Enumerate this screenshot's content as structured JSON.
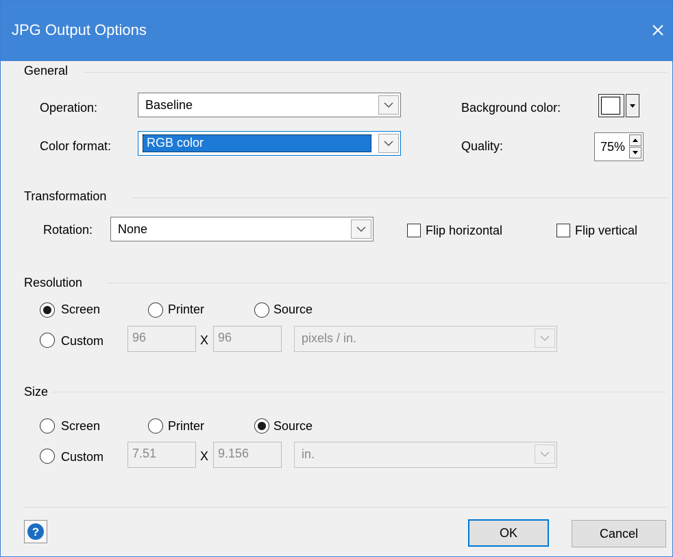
{
  "window": {
    "title": "JPG Output Options"
  },
  "general": {
    "label": "General",
    "operation": {
      "label": "Operation:",
      "value": "Baseline"
    },
    "color_format": {
      "label": "Color format:",
      "value": "RGB color"
    },
    "background_color": {
      "label": "Background color:",
      "value": "#ffffff"
    },
    "quality": {
      "label": "Quality:",
      "value": "75%"
    }
  },
  "transformation": {
    "label": "Transformation",
    "rotation": {
      "label": "Rotation:",
      "value": "None"
    },
    "flip_horizontal": {
      "label": "Flip horizontal",
      "checked": false
    },
    "flip_vertical": {
      "label": "Flip vertical",
      "checked": false
    }
  },
  "resolution": {
    "label": "Resolution",
    "options": {
      "screen": "Screen",
      "printer": "Printer",
      "source": "Source",
      "custom": "Custom"
    },
    "selected": "Screen",
    "custom_x": "96",
    "separator": "X",
    "custom_y": "96",
    "unit": "pixels / in."
  },
  "size": {
    "label": "Size",
    "options": {
      "screen": "Screen",
      "printer": "Printer",
      "source": "Source",
      "custom": "Custom"
    },
    "selected": "Source",
    "custom_width": "7.51",
    "separator": "X",
    "custom_height": "9.156",
    "unit": "in."
  },
  "buttons": {
    "ok": "OK",
    "cancel": "Cancel"
  },
  "colors": {
    "titlebar": "#3e85d8",
    "accent": "#0078d7",
    "help_icon": "#1b6ec2"
  }
}
